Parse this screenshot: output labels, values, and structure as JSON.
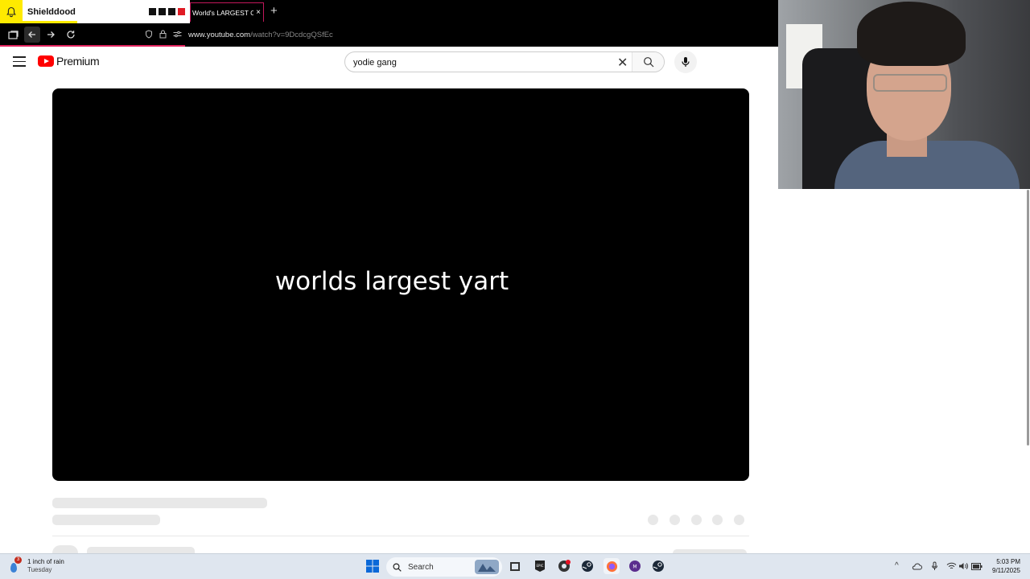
{
  "browser": {
    "extension_tab_title": "Shielddood",
    "active_tab_title": "World's LARGEST Car",
    "close_tab_glyph": "×",
    "new_tab_glyph": "+",
    "url_domain": "www.youtube.com",
    "url_path": "/watch?v=9DcdcgQSfEc"
  },
  "youtube": {
    "logo_text": "Premium",
    "search_value": "yodie gang",
    "clear_glyph": "✕"
  },
  "player": {
    "caption": "worlds largest yart"
  },
  "taskbar": {
    "weather_badge": "3",
    "weather_line1": "1 inch of rain",
    "weather_line2": "Tuesday",
    "search_label": "Search",
    "time": "5:03 PM",
    "date": "9/11/2025"
  },
  "colors": {
    "accent_red": "#ff0000",
    "tab_border": "#c2185b",
    "extension_yellow": "#ffea00"
  }
}
